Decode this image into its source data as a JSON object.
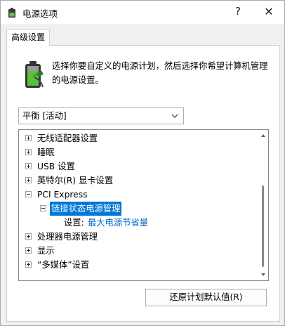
{
  "window": {
    "title": "电源选项",
    "help_glyph": "?",
    "close_glyph": "✕"
  },
  "tab": {
    "label": "高级设置"
  },
  "description": "选择你要自定义的电源计划，然后选择你希望计算机管理的电源设置。",
  "plan_select": {
    "value": "平衡 [活动]"
  },
  "tree": {
    "items": [
      {
        "label": "无线适配器设置",
        "expander": "+"
      },
      {
        "label": "睡眠",
        "expander": "+"
      },
      {
        "label": "USB 设置",
        "expander": "+"
      },
      {
        "label": "英特尔(R) 显卡设置",
        "expander": "+"
      },
      {
        "label": "PCI Express",
        "expander": "−"
      },
      {
        "label": "链接状态电源管理",
        "expander": "−",
        "selected": true
      },
      {
        "label": "设置:",
        "value": "最大电源节省量"
      },
      {
        "label": "处理器电源管理",
        "expander": "+"
      },
      {
        "label": "显示",
        "expander": "+"
      },
      {
        "label": "“多媒体”设置",
        "expander": "+"
      }
    ]
  },
  "buttons": {
    "restore_defaults": "还原计划默认值(R)"
  },
  "colors": {
    "selection": "#0078d7",
    "link": "#0066cc"
  }
}
